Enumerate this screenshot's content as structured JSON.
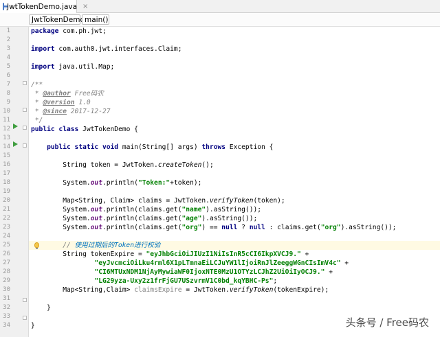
{
  "file_tab": {
    "label": "JwtTokenDemo.java",
    "close": "×"
  },
  "breadcrumb": {
    "class_name": "JwtTokenDemo",
    "method_name": "main()"
  },
  "line_numbers": [
    "1",
    "2",
    "3",
    "4",
    "5",
    "6",
    "7",
    "8",
    "9",
    "10",
    "11",
    "12",
    "13",
    "14",
    "15",
    "16",
    "17",
    "18",
    "19",
    "20",
    "21",
    "22",
    "23",
    "24",
    "25",
    "26",
    "27",
    "28",
    "29",
    "30",
    "31",
    "32",
    "33",
    "34"
  ],
  "code": {
    "l1_kw": "package",
    "l1_rest": " com.ph.jwt;",
    "l3_kw": "import",
    "l3_rest": " com.auth0.jwt.interfaces.Claim;",
    "l5_kw": "import",
    "l5_rest": " java.util.Map;",
    "l7": "/**",
    "l8_star": " * ",
    "l8_tag": "@author",
    "l8_val": " Free码农",
    "l9_star": " * ",
    "l9_tag": "@version",
    "l9_val": " 1.0",
    "l10_star": " * ",
    "l10_tag": "@since",
    "l10_val": " 2017-12-27",
    "l11": " */",
    "l12_kw": "public class",
    "l12_rest": " JwtTokenDemo {",
    "l14_indent": "    ",
    "l14_kw": "public static void",
    "l14_mid": " main(String[] args) ",
    "l14_kw2": "throws",
    "l14_rest": " Exception {",
    "l16_a": "        String token = JwtToken.",
    "l16_call": "createToken",
    "l16_b": "();",
    "l18_a": "        System.",
    "l18_out": "out",
    "l18_b": ".println(",
    "l18_str": "\"Token:\"",
    "l18_c": "+token);",
    "l20_a": "        Map<String, Claim> claims = JwtToken.",
    "l20_call": "verifyToken",
    "l20_b": "(token);",
    "l21_a": "        System.",
    "l21_out": "out",
    "l21_b": ".println(claims.get(",
    "l21_str": "\"name\"",
    "l21_c": ").asString());",
    "l22_a": "        System.",
    "l22_out": "out",
    "l22_b": ".println(claims.get(",
    "l22_str": "\"age\"",
    "l22_c": ").asString());",
    "l23_a": "        System.",
    "l23_out": "out",
    "l23_b": ".println(claims.get(",
    "l23_str": "\"org\"",
    "l23_c": ") == ",
    "l23_kw": "null",
    "l23_d": " ? ",
    "l23_kw2": "null",
    "l23_e": " : claims.get(",
    "l23_str2": "\"org\"",
    "l23_f": ").asString());",
    "l25_a": "        // ",
    "l25_cmt": "使用过期后的Token进行校验",
    "l26_a": "        String tokenExpire = ",
    "l26_str": "\"eyJhbGciOiJIUzI1NiIsInR5cCI6IkpXVCJ9.\"",
    "l26_b": " +",
    "l27_a": "                ",
    "l27_str": "\"eyJvcmciOiLku4rml6X1pLTmnaEiLCJuYW1lIjoiRnJlZeeggWGnCIsImV4c\"",
    "l27_b": " +",
    "l28_a": "                ",
    "l28_str": "\"CI6MTUxNDM1NjAyMywiaWF0IjoxNTE0MzU1OTYzLCJhZ2UiOiIyOCJ9.\"",
    "l28_b": " +",
    "l29_a": "                ",
    "l29_str": "\"LG29yza-Uxy2z1frFjGU7USzvrmV1C0bd_kqYBHC-Ps\"",
    "l29_b": ";",
    "l30_a": "        Map<String,Claim> ",
    "l30_unused": "claimsExpire",
    "l30_b": " = JwtToken.",
    "l30_call": "verifyToken",
    "l30_c": "(tokenExpire);",
    "l32": "    }",
    "l34": "}"
  },
  "watermark": "头条号 / Free码农",
  "colors": {
    "keyword": "#000080",
    "string": "#008000",
    "comment": "#808080",
    "static_field": "#660e7a",
    "run_icon": "#3f9e3f",
    "highlight": "#fffae3"
  },
  "icons": {
    "run": "run-arrow-icon",
    "bulb": "intention-bulb-icon",
    "file": "java-file-icon"
  }
}
